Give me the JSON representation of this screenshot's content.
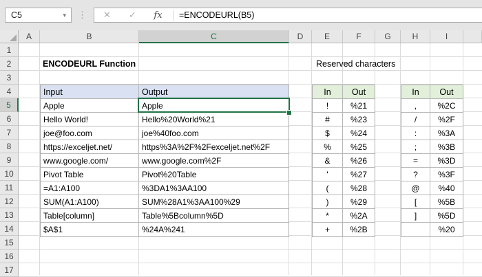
{
  "formula_bar": {
    "cell_reference": "C5",
    "formula": "=ENCODEURL(B5)",
    "cancel_icon": "✕",
    "enter_icon": "✓",
    "fx_icon": "fx",
    "caret_icon": "▾",
    "separator_icon": "⋮"
  },
  "sheet": {
    "column_headers": [
      "A",
      "B",
      "C",
      "D",
      "E",
      "F",
      "G",
      "H",
      "I"
    ],
    "row_headers": [
      "1",
      "2",
      "3",
      "4",
      "5",
      "6",
      "7",
      "8",
      "9",
      "10",
      "11",
      "12",
      "13",
      "14",
      "15",
      "16",
      "17"
    ],
    "selected_column": "C",
    "selected_row": "5",
    "title": "ENCODEURL Function",
    "reserved_label": "Reserved characters"
  },
  "main_table": {
    "headers": [
      "Input",
      "Output"
    ],
    "rows": [
      [
        "Apple",
        "Apple"
      ],
      [
        "Hello World!",
        "Hello%20World%21"
      ],
      [
        "joe@foo.com",
        "joe%40foo.com"
      ],
      [
        "https://exceljet.net/",
        "https%3A%2F%2Fexceljet.net%2F"
      ],
      [
        "www.google.com/",
        "www.google.com%2F"
      ],
      [
        "Pivot Table",
        "Pivot%20Table"
      ],
      [
        "=A1:A100",
        "%3DA1%3AA100"
      ],
      [
        "SUM(A1:A100)",
        "SUM%28A1%3AA100%29"
      ],
      [
        "Table[column]",
        "Table%5Bcolumn%5D"
      ],
      [
        "$A$1",
        "%24A%241"
      ]
    ]
  },
  "reserved_table_1": {
    "headers": [
      "In",
      "Out"
    ],
    "rows": [
      [
        "!",
        "%21"
      ],
      [
        "#",
        "%23"
      ],
      [
        "$",
        "%24"
      ],
      [
        "%",
        "%25"
      ],
      [
        "&",
        "%26"
      ],
      [
        "'",
        "%27"
      ],
      [
        "(",
        "%28"
      ],
      [
        ")",
        "%29"
      ],
      [
        "*",
        "%2A"
      ],
      [
        "+",
        "%2B"
      ]
    ]
  },
  "reserved_table_2": {
    "headers": [
      "In",
      "Out"
    ],
    "rows": [
      [
        ",",
        "%2C"
      ],
      [
        "/",
        "%2F"
      ],
      [
        ":",
        "%3A"
      ],
      [
        ";",
        "%3B"
      ],
      [
        "=",
        "%3D"
      ],
      [
        "?",
        "%3F"
      ],
      [
        "@",
        "%40"
      ],
      [
        "[",
        "%5B"
      ],
      [
        "]",
        "%5D"
      ],
      [
        "",
        "%20"
      ]
    ]
  },
  "colors": {
    "excel_green": "#217346",
    "main_table_header_fill": "#D9E1F2",
    "reserved_table_header_fill": "#E2EFDA",
    "header_bar_fill": "#E8E8E8",
    "toolbar_fill": "#E5E5E5"
  }
}
